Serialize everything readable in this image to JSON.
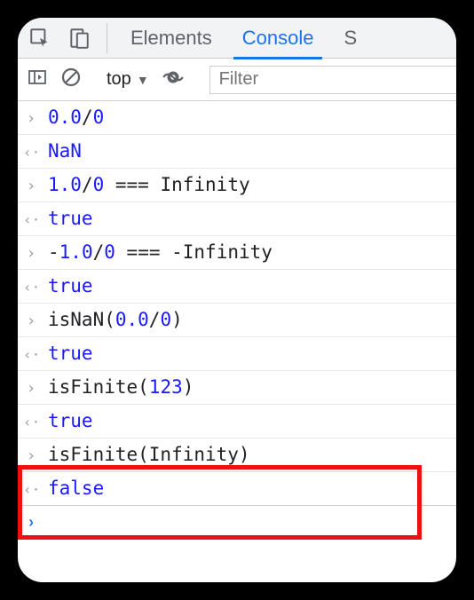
{
  "tabs": {
    "elements": "Elements",
    "console": "Console",
    "sources_partial": "S"
  },
  "toolbar": {
    "context": "top",
    "filter_placeholder": "Filter"
  },
  "rows": [
    {
      "type": "in",
      "tokens": [
        {
          "t": "num",
          "v": "0.0"
        },
        {
          "t": "plain",
          "v": "/"
        },
        {
          "t": "num",
          "v": "0"
        }
      ]
    },
    {
      "type": "out",
      "tokens": [
        {
          "t": "nan",
          "v": "NaN"
        }
      ]
    },
    {
      "type": "in",
      "tokens": [
        {
          "t": "num",
          "v": "1.0"
        },
        {
          "t": "plain",
          "v": "/"
        },
        {
          "t": "num",
          "v": "0"
        },
        {
          "t": "plain",
          "v": " === Infinity"
        }
      ]
    },
    {
      "type": "out",
      "tokens": [
        {
          "t": "bool",
          "v": "true"
        }
      ]
    },
    {
      "type": "in",
      "tokens": [
        {
          "t": "plain",
          "v": "-"
        },
        {
          "t": "num",
          "v": "1.0"
        },
        {
          "t": "plain",
          "v": "/"
        },
        {
          "t": "num",
          "v": "0"
        },
        {
          "t": "plain",
          "v": " === -Infinity"
        }
      ]
    },
    {
      "type": "out",
      "tokens": [
        {
          "t": "bool",
          "v": "true"
        }
      ]
    },
    {
      "type": "in",
      "tokens": [
        {
          "t": "plain",
          "v": "isNaN("
        },
        {
          "t": "num",
          "v": "0.0"
        },
        {
          "t": "plain",
          "v": "/"
        },
        {
          "t": "num",
          "v": "0"
        },
        {
          "t": "plain",
          "v": ")"
        }
      ]
    },
    {
      "type": "out",
      "tokens": [
        {
          "t": "bool",
          "v": "true"
        }
      ]
    },
    {
      "type": "in",
      "tokens": [
        {
          "t": "plain",
          "v": "isFinite("
        },
        {
          "t": "num",
          "v": "123"
        },
        {
          "t": "plain",
          "v": ")"
        }
      ]
    },
    {
      "type": "out",
      "tokens": [
        {
          "t": "bool",
          "v": "true"
        }
      ]
    },
    {
      "type": "in",
      "tokens": [
        {
          "t": "plain",
          "v": "isFinite(Infinity)"
        }
      ]
    },
    {
      "type": "out",
      "tokens": [
        {
          "t": "bool",
          "v": "false"
        }
      ]
    }
  ],
  "gutters": {
    "in": "›",
    "out": "‹·"
  }
}
